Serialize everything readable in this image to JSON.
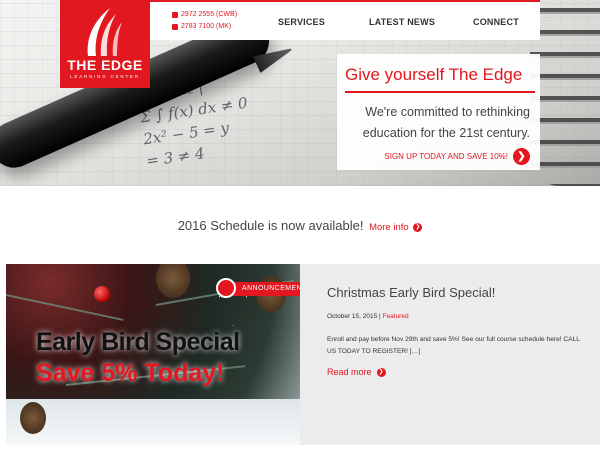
{
  "brand": {
    "name": "THE EDGE",
    "tagline": "LEARNING CENTER",
    "accent_color": "#e2171f"
  },
  "contact": {
    "phone_1": "2972 2555 (CWB)",
    "phone_2": "2783 7100 (MK)",
    "icon": "phone-icon"
  },
  "nav": {
    "items": [
      {
        "label": "SERVICES"
      },
      {
        "label": "LATEST NEWS"
      },
      {
        "label": "CONNECT"
      }
    ]
  },
  "hero": {
    "headline": "Give yourself The Edge",
    "body": "We're committed to rethinking education for the 21st century.",
    "cta_label": "SIGN UP TODAY AND SAVE 10%!",
    "cta_icon": "arrow-right-circle-icon"
  },
  "schedule": {
    "text": "2016 Schedule is now available!",
    "link_label": "More info"
  },
  "post": {
    "badge": "ANNOUNCEMENT",
    "image_line_1": "Early Bird Special",
    "image_line_2": "Save 5% Today!",
    "title": "Christmas Early Bird Special!",
    "date": "October 15, 2015",
    "separator": "|",
    "category": "Featured",
    "excerpt": "Enroll and pay before Nov 29th and save 5%! See our full course schedule here! CALL US TODAY TO REGISTER! […]",
    "read_more": "Read more"
  }
}
